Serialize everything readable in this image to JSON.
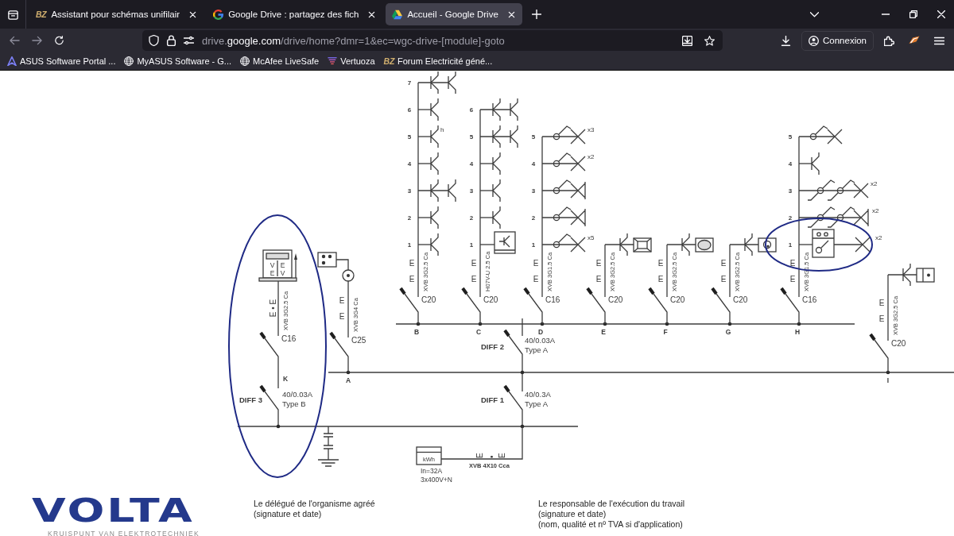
{
  "browser": {
    "tabs": [
      {
        "kind": "monogram",
        "monogram": "BZ",
        "title": "Assistant pour schémas unifilair",
        "selected": false
      },
      {
        "kind": "google",
        "title": "Google Drive : partagez des fich",
        "selected": false
      },
      {
        "kind": "drive",
        "title": "Accueil - Google Drive",
        "selected": true
      }
    ],
    "nav_buttons": [
      {
        "kind": "back",
        "disabled": true
      },
      {
        "kind": "forward",
        "disabled": true
      },
      {
        "kind": "reload",
        "disabled": false
      }
    ],
    "address": {
      "subdomain": "drive.",
      "domain": "google.com",
      "path": "/drive/home?dmr=1&ec=wgc-drive-[module]-goto"
    },
    "account_button": "Connexion",
    "bookmarks": [
      {
        "kind": "asus",
        "label": "ASUS Software Portal ..."
      },
      {
        "kind": "globe",
        "label": "MyASUS Software - G..."
      },
      {
        "kind": "globe",
        "label": "McAfee LiveSafe"
      },
      {
        "kind": "stripes",
        "label": "Vertuoza"
      },
      {
        "kind": "monogram",
        "monogram": "BZ",
        "label": "Forum Electricité géné..."
      }
    ]
  },
  "schematic": {
    "upper_circuits": [
      {
        "letter": "B",
        "breaker": "C20",
        "cable": "XVB 3G2.5 Ca",
        "earth_marks": [
          "E",
          "E"
        ],
        "points": [
          {
            "number": "7",
            "kind": "twin"
          },
          {
            "number": "6",
            "kind": "socket"
          },
          {
            "number": "5",
            "kind": "socket",
            "note": "h"
          },
          {
            "number": "4",
            "kind": "socket"
          },
          {
            "number": "3",
            "kind": "twin"
          },
          {
            "number": "2",
            "kind": "socket"
          },
          {
            "number": "1",
            "kind": "socket"
          }
        ]
      },
      {
        "letter": "C",
        "breaker": "C20",
        "cable": "H07V-U 2.5 Ca",
        "earth_marks": [
          "E",
          "E"
        ],
        "points": [
          {
            "number": "6",
            "kind": "twin"
          },
          {
            "number": "5",
            "kind": "twin"
          },
          {
            "number": "4",
            "kind": "socket"
          },
          {
            "number": "3",
            "kind": "socket"
          },
          {
            "number": "2",
            "kind": "socket"
          },
          {
            "number": "1",
            "kind": "boxsocket"
          }
        ]
      },
      {
        "letter": "D",
        "breaker": "C16",
        "cable": "XVB 3G1.5 Ca",
        "earth_marks": [
          "E",
          "E"
        ],
        "points": [
          {
            "number": "5",
            "kind": "lamp",
            "note": "x3"
          },
          {
            "number": "4",
            "kind": "lamp",
            "note": "x2"
          },
          {
            "number": "3",
            "kind": "spot"
          },
          {
            "number": "2",
            "kind": "spot"
          },
          {
            "number": "1",
            "kind": "lamp",
            "note": "x5"
          }
        ]
      },
      {
        "letter": "E",
        "breaker": "C20",
        "cable": "XVB 3G2.5 Ca",
        "earth_marks": [
          "E",
          "E"
        ],
        "points": [
          {
            "kind": "square"
          }
        ]
      },
      {
        "letter": "F",
        "breaker": "C20",
        "cable": "XVB 3G2.5 Ca",
        "earth_marks": [
          "E",
          "E"
        ],
        "points": [
          {
            "kind": "oval"
          }
        ]
      },
      {
        "letter": "G",
        "breaker": "C20",
        "cable": "XVB 3G2.5 Ca",
        "earth_marks": [
          "E",
          "E"
        ],
        "points": [
          {
            "kind": "disc"
          }
        ]
      },
      {
        "letter": "H",
        "breaker": "C16",
        "cable": "XVB 3G1.5 Ca",
        "earth_marks": [
          "E",
          "E"
        ],
        "points": [
          {
            "number": "5",
            "kind": "lamp"
          },
          {
            "number": "4",
            "kind": "socket"
          },
          {
            "number": "3",
            "kind": "twoway",
            "note": "x2"
          },
          {
            "number": "2",
            "kind": "twowayspot",
            "note": "x2"
          },
          {
            "number": "1",
            "kind": "boxlamp",
            "note": "x2"
          }
        ]
      }
    ],
    "circuit_k": {
      "letter": "K",
      "breaker": "C16",
      "cable": "XVB 3G2.5 Ca",
      "earth_marks": [
        "E • E"
      ],
      "charger_labels": [
        "V",
        "E",
        "E",
        "V"
      ]
    },
    "circuit_a": {
      "letter": "A",
      "breaker": "C25",
      "cable": "XVB 3G4 Ca",
      "earth_marks": [
        "E",
        "E"
      ]
    },
    "circuit_i": {
      "letter": "I",
      "breaker": "C20",
      "cable": "XVB 3G2.5 Ca",
      "earth_marks": [
        "E",
        "E"
      ],
      "points": [
        {
          "kind": "dot"
        }
      ]
    },
    "differentials": [
      {
        "name": "DIFF 2",
        "rating": "40/0.03A",
        "type": "Type A"
      },
      {
        "name": "DIFF 3",
        "rating": "40/0.03A",
        "type": "Type B"
      },
      {
        "name": "DIFF 1",
        "rating": "40/0.3A",
        "type": "Type A"
      }
    ],
    "supply": {
      "earth_marks": "E • E",
      "cable": "XVB 4X10 Cca",
      "meter": "kWh",
      "rating": "In=32A",
      "network": "3x400V+N"
    }
  },
  "footer": {
    "logo": "VOLTA",
    "tagline": "KRUISPUNT VAN ELEKTROTECHNIEK",
    "signatures": [
      {
        "lines": [
          "Le délégué de l'organisme agréé",
          "(signature et date)"
        ]
      },
      {
        "lines": [
          "Le responsable de l'exécution du travail",
          "(signature et date)",
          "(nom, qualité et nº TVA si d'application)"
        ]
      }
    ]
  }
}
